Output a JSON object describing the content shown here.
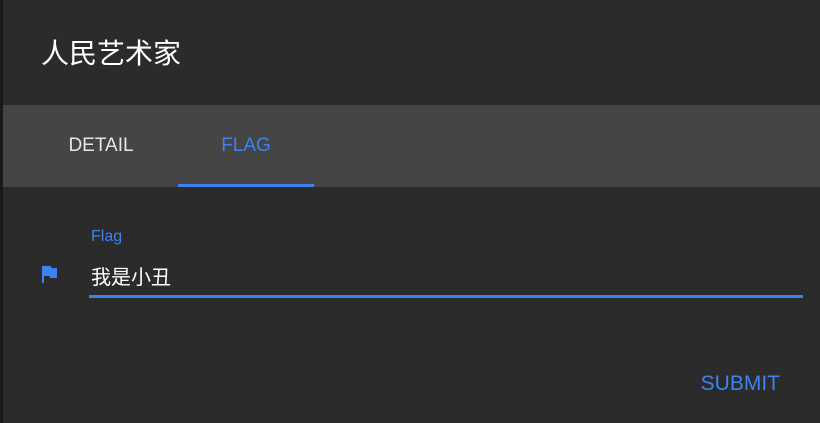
{
  "dialog": {
    "title": "人民艺术家"
  },
  "tabs": [
    {
      "label": "DETAIL",
      "active": false
    },
    {
      "label": "FLAG",
      "active": true
    }
  ],
  "flag_field": {
    "label": "Flag",
    "value": "我是小丑",
    "icon": "flag-icon"
  },
  "actions": {
    "submit_label": "SUBMIT"
  },
  "colors": {
    "accent": "#3d82f0",
    "dialog_background": "#2b2b2b",
    "tab_bar_background": "#454545",
    "text": "#ffffff"
  }
}
